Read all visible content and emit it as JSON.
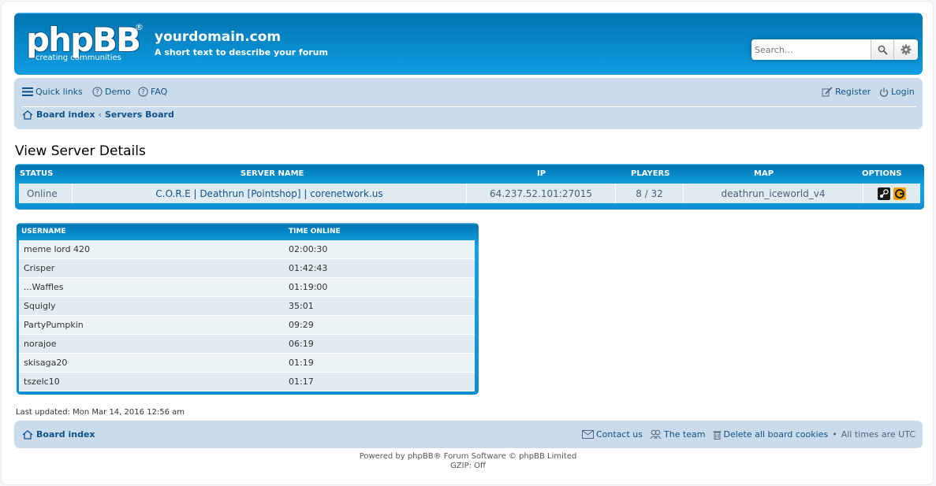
{
  "header": {
    "logo_word": "phpBB",
    "logo_reg": "®",
    "logo_tagline": "creating   communities",
    "site_title": "yourdomain.com",
    "site_desc": "A short text to describe your forum",
    "search_placeholder": "Search…"
  },
  "nav": {
    "quick_links": "Quick links",
    "demo": "Demo",
    "faq": "FAQ",
    "register": "Register",
    "login": "Login",
    "crumb_home": "Board index",
    "crumb_sep": "‹",
    "crumb_current": "Servers Board"
  },
  "page_title": "View Server Details",
  "server_table": {
    "headers": [
      "STATUS",
      "SERVER NAME",
      "IP",
      "PLAYERS",
      "MAP",
      "OPTIONS"
    ],
    "row": {
      "status": "Online",
      "name": "C.O.R.E | Deathrun [Pointshop] | corenetwork.us",
      "ip": "64.237.52.101:27015",
      "players": "8 / 32",
      "map": "deathrun_iceworld_v4"
    }
  },
  "players_table": {
    "headers": [
      "USERNAME",
      "TIME ONLINE"
    ],
    "rows": [
      {
        "username": "meme lord 420",
        "time": "02:00:30"
      },
      {
        "username": "Crisper",
        "time": "01:42:43"
      },
      {
        "username": "...Waffles",
        "time": "01:19:00"
      },
      {
        "username": "Squigly",
        "time": "35:01"
      },
      {
        "username": "PartyPumpkin",
        "time": "09:29"
      },
      {
        "username": "norajoe",
        "time": "06:19"
      },
      {
        "username": "skisaga20",
        "time": "01:19"
      },
      {
        "username": "tszelc10",
        "time": "01:17"
      }
    ]
  },
  "last_updated": "Last updated: Mon Mar 14, 2016 12:56 am",
  "footer": {
    "board_index": "Board index",
    "contact": "Contact us",
    "team": "The team",
    "delete_cookies": "Delete all board cookies",
    "bullet": "•",
    "timezone": "All times are UTC",
    "powered": "Powered by phpBB® Forum Software © phpBB Limited",
    "gzip": "GZIP: Off"
  },
  "colors": {
    "header_blue": "#12a3eb",
    "nav_bg": "#cadceb",
    "link": "#105289"
  }
}
